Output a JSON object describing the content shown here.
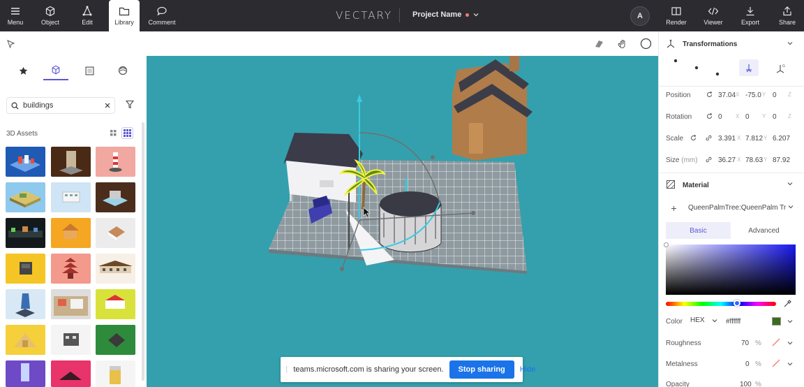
{
  "topbar": {
    "menu_label": "Menu",
    "object_label": "Object",
    "edit_label": "Edit",
    "library_label": "Library",
    "comment_label": "Comment",
    "brand": "VECTARY",
    "project_name": "Project Name",
    "avatar_initial": "A",
    "render_label": "Render",
    "viewer_label": "Viewer",
    "export_label": "Export",
    "share_label": "Share"
  },
  "library": {
    "tabs": [
      "favorites",
      "3d-objects",
      "materials",
      "environments"
    ],
    "active_tab": "3d-objects",
    "search_value": "buildings",
    "section_label": "3D Assets"
  },
  "sharebar": {
    "message": "teams.microsoft.com is sharing your screen.",
    "stop_label": "Stop sharing",
    "hide_label": "Hide"
  },
  "properties": {
    "transformations_title": "Transformations",
    "position_label": "Position",
    "position": [
      "37.04",
      "-75.0",
      "0"
    ],
    "rotation_label": "Rotation",
    "rotation": [
      "0",
      "0",
      "0"
    ],
    "scale_label": "Scale",
    "scale": [
      "3.391",
      "7.812",
      "6.207"
    ],
    "size_label": "Size",
    "size_unit": "(mm)",
    "size": [
      "36.27",
      "78.63",
      "87.92"
    ],
    "axis_labels": [
      "X",
      "Y",
      "Z"
    ],
    "material_title": "Material",
    "material_name": "QueenPalmTree:QueenPalm Tr",
    "basic_tab": "Basic",
    "advanced_tab": "Advanced",
    "color_label": "Color",
    "color_format": "HEX",
    "color_value": "#ffffff",
    "swatch_color": "#3e6a1e",
    "roughness_label": "Roughness",
    "roughness_value": "70",
    "metalness_label": "Metalness",
    "metalness_value": "0",
    "opacity_label": "Opacity",
    "opacity_value": "100",
    "percent": "%"
  },
  "colors": {
    "accent": "#5b57d1",
    "viewport_bg": "#34a0ad",
    "topbar_bg": "#2c2b30",
    "teams_blue": "#1a73e8"
  }
}
